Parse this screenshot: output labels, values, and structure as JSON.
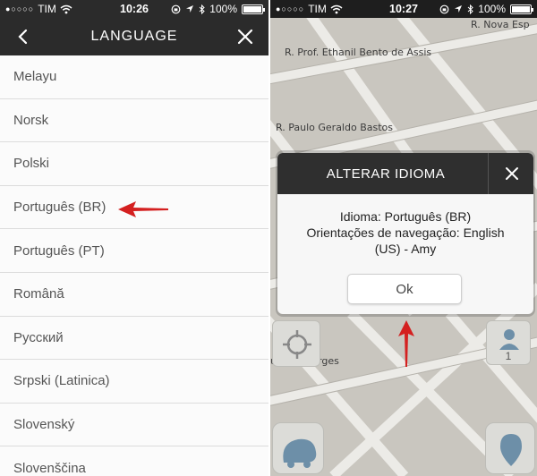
{
  "left": {
    "status": {
      "signal": "●○○○○",
      "carrier": "TIM",
      "time": "10:26",
      "battery": "100%"
    },
    "nav": {
      "title": "LANGUAGE",
      "back_icon": "chevron-left-icon",
      "close_icon": "close-icon"
    },
    "languages": [
      {
        "label": "Melayu"
      },
      {
        "label": "Norsk"
      },
      {
        "label": "Polski"
      },
      {
        "label": "Português (BR)"
      },
      {
        "label": "Português (PT)"
      },
      {
        "label": "Română"
      },
      {
        "label": "Русский"
      },
      {
        "label": "Srpski (Latinica)"
      },
      {
        "label": "Slovenský"
      },
      {
        "label": "Slovenščina"
      }
    ]
  },
  "right": {
    "status": {
      "signal": "●○○○○",
      "carrier": "TIM",
      "time": "10:27",
      "battery": "100%"
    },
    "streets": {
      "s1": "R. Nova Esp",
      "s2": "R. Prof. Ethanil Bento de Assis",
      "s3": "R. Paulo Geraldo Bastos",
      "s4": "urindo Borges"
    },
    "dialog": {
      "title": "ALTERAR IDIOMA",
      "line1": "Idioma: Português (BR)",
      "line2": "Orientações de navegação: English",
      "line3": "(US) - Amy",
      "ok_label": "Ok"
    },
    "user_count": "1"
  },
  "colors": {
    "bar": "#2b2b2b",
    "arrow": "#d42020",
    "map": "#c9c6bf"
  }
}
